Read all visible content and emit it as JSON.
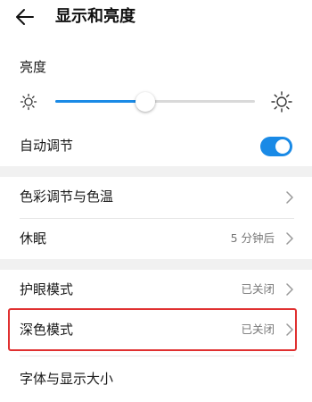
{
  "header": {
    "back_icon": "arrow-left-icon",
    "title": "显示和亮度"
  },
  "brightness": {
    "label": "亮度",
    "level": 0.45,
    "min_icon": "sun-small-icon",
    "max_icon": "sun-large-icon"
  },
  "auto_adjust": {
    "label": "自动调节",
    "enabled": true
  },
  "items": [
    {
      "label": "色彩调节与色温",
      "value": "",
      "chevron": true
    },
    {
      "label": "休眠",
      "value": "5 分钟后",
      "chevron": true
    },
    {
      "label": "护眼模式",
      "value": "已关闭",
      "chevron": true
    },
    {
      "label": "深色模式",
      "value": "已关闭",
      "chevron": true,
      "highlighted": true
    },
    {
      "label": "字体与显示大小",
      "value": "",
      "chevron": false
    }
  ],
  "colors": {
    "accent": "#1a8ae6",
    "highlight": "#e03030",
    "section_bg": "#f1f1f1"
  }
}
